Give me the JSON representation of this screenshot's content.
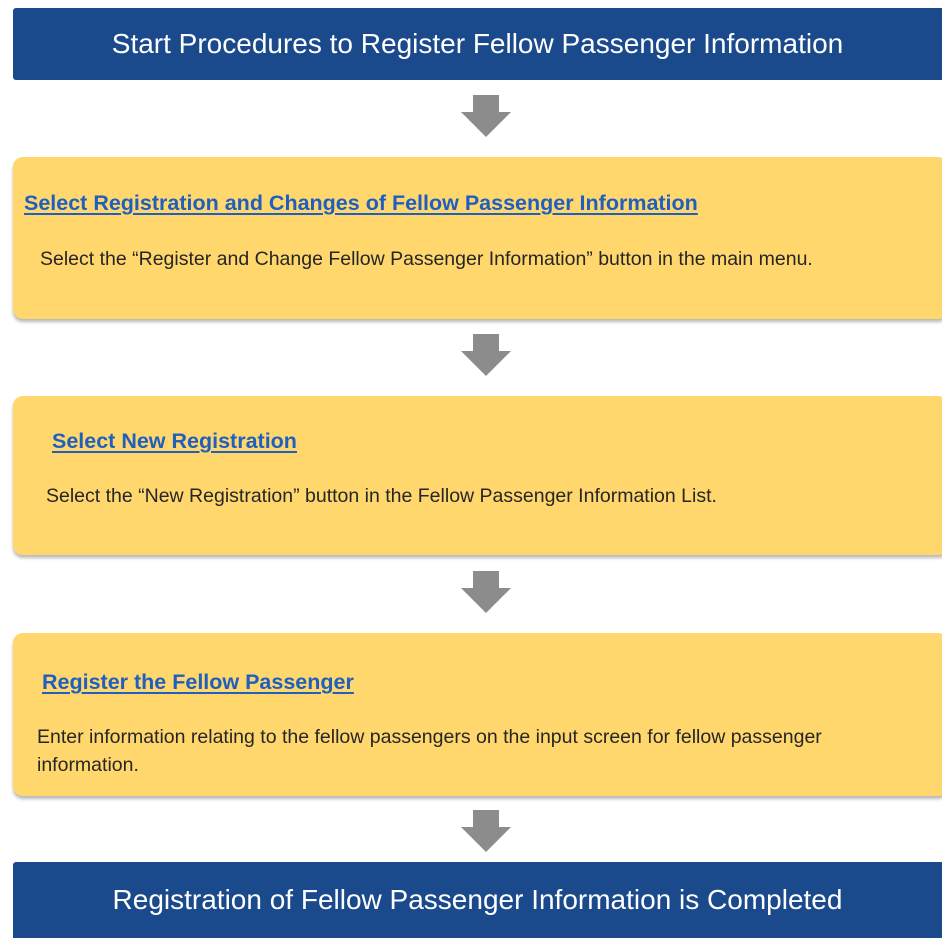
{
  "header": {
    "title": "Start Procedures to Register Fellow Passenger Information"
  },
  "steps": [
    {
      "title": "Select Registration and Changes of Fellow Passenger Information",
      "description": "Select the “Register and Change Fellow Passenger Information” button in the main menu."
    },
    {
      "title": "Select New Registration",
      "description": "Select the “New Registration” button in the Fellow Passenger Information List."
    },
    {
      "title": "Register the Fellow Passenger",
      "description": "Enter information relating to the fellow passengers on the input screen for fellow passenger information."
    }
  ],
  "footer": {
    "title": "Registration of Fellow Passenger Information is Completed"
  },
  "colors": {
    "banner": "#1b4a8c",
    "step_box": "#ffd76c",
    "step_title": "#1f5fbf",
    "arrow": "#8c8c8c"
  },
  "icons": {
    "connector": "down-arrow-icon"
  }
}
